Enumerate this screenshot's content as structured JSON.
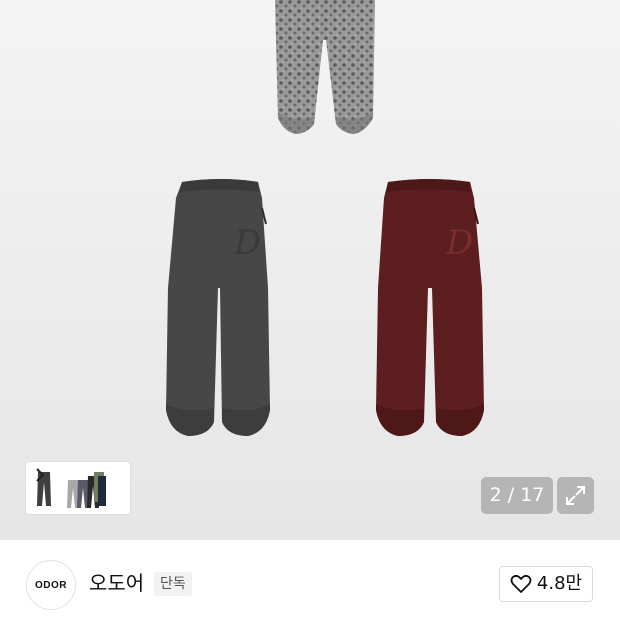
{
  "gallery": {
    "counter": "2 / 17",
    "icons": {
      "expand": "expand-arrows-icon",
      "chevron": "chevron-right-icon"
    },
    "colors": {
      "leopard_pants": "#8f8f8f",
      "charcoal_pants": "#474747",
      "burgundy_pants": "#5c1e1f"
    }
  },
  "brand": {
    "logo_text": "ODOR",
    "name": "오도어",
    "badge": "단독",
    "like_icon": "heart-outline-icon",
    "like_count": "4.8만"
  }
}
